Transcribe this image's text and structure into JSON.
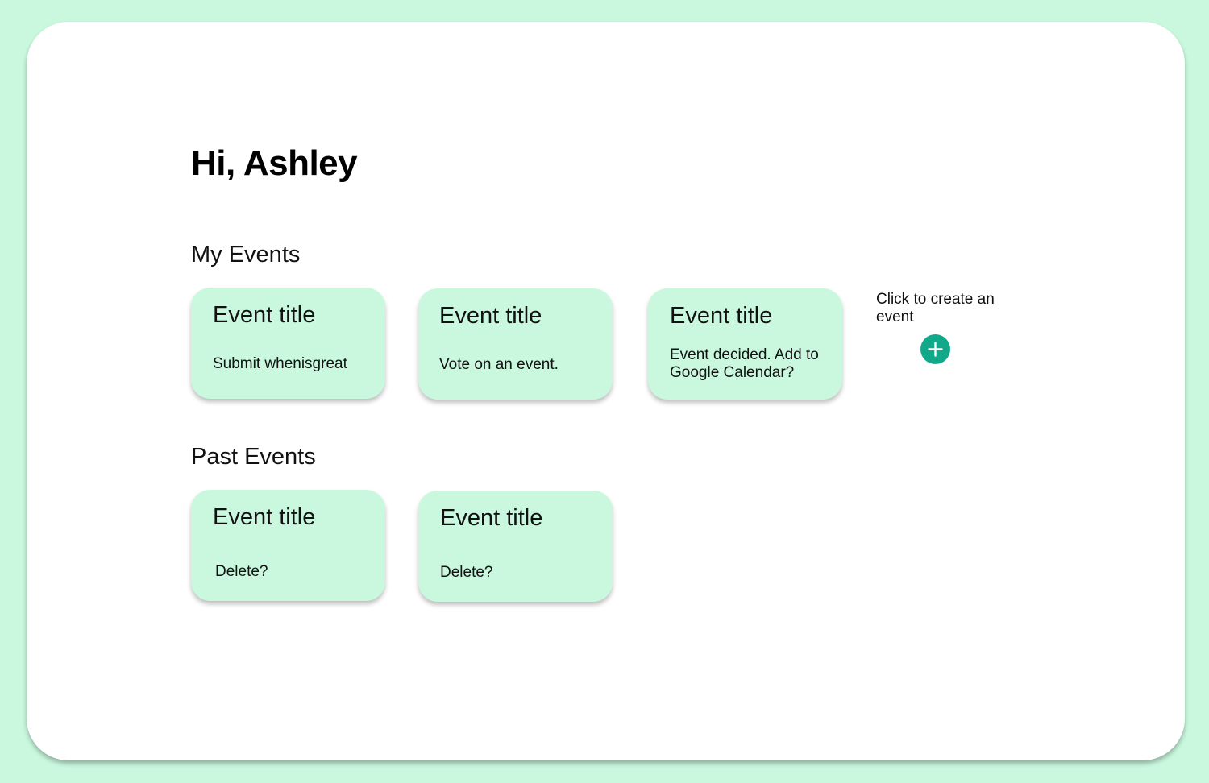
{
  "greeting": "Hi, Ashley",
  "sections": {
    "my_events": {
      "title": "My Events",
      "cards": [
        {
          "title": "Event title",
          "status": "Submit whenisgreat"
        },
        {
          "title": "Event title",
          "status": "Vote on an event."
        },
        {
          "title": "Event title",
          "status": "Event decided. Add to Google Calendar?"
        }
      ]
    },
    "past_events": {
      "title": "Past Events",
      "cards": [
        {
          "title": "Event title",
          "status": "Delete?"
        },
        {
          "title": "Event title",
          "status": "Delete?"
        }
      ]
    }
  },
  "create": {
    "label": "Click to create an event",
    "icon": "plus-icon"
  },
  "colors": {
    "background": "#c9f8de",
    "card": "#c9f8de",
    "panel": "#ffffff",
    "accent": "#12a88a"
  }
}
